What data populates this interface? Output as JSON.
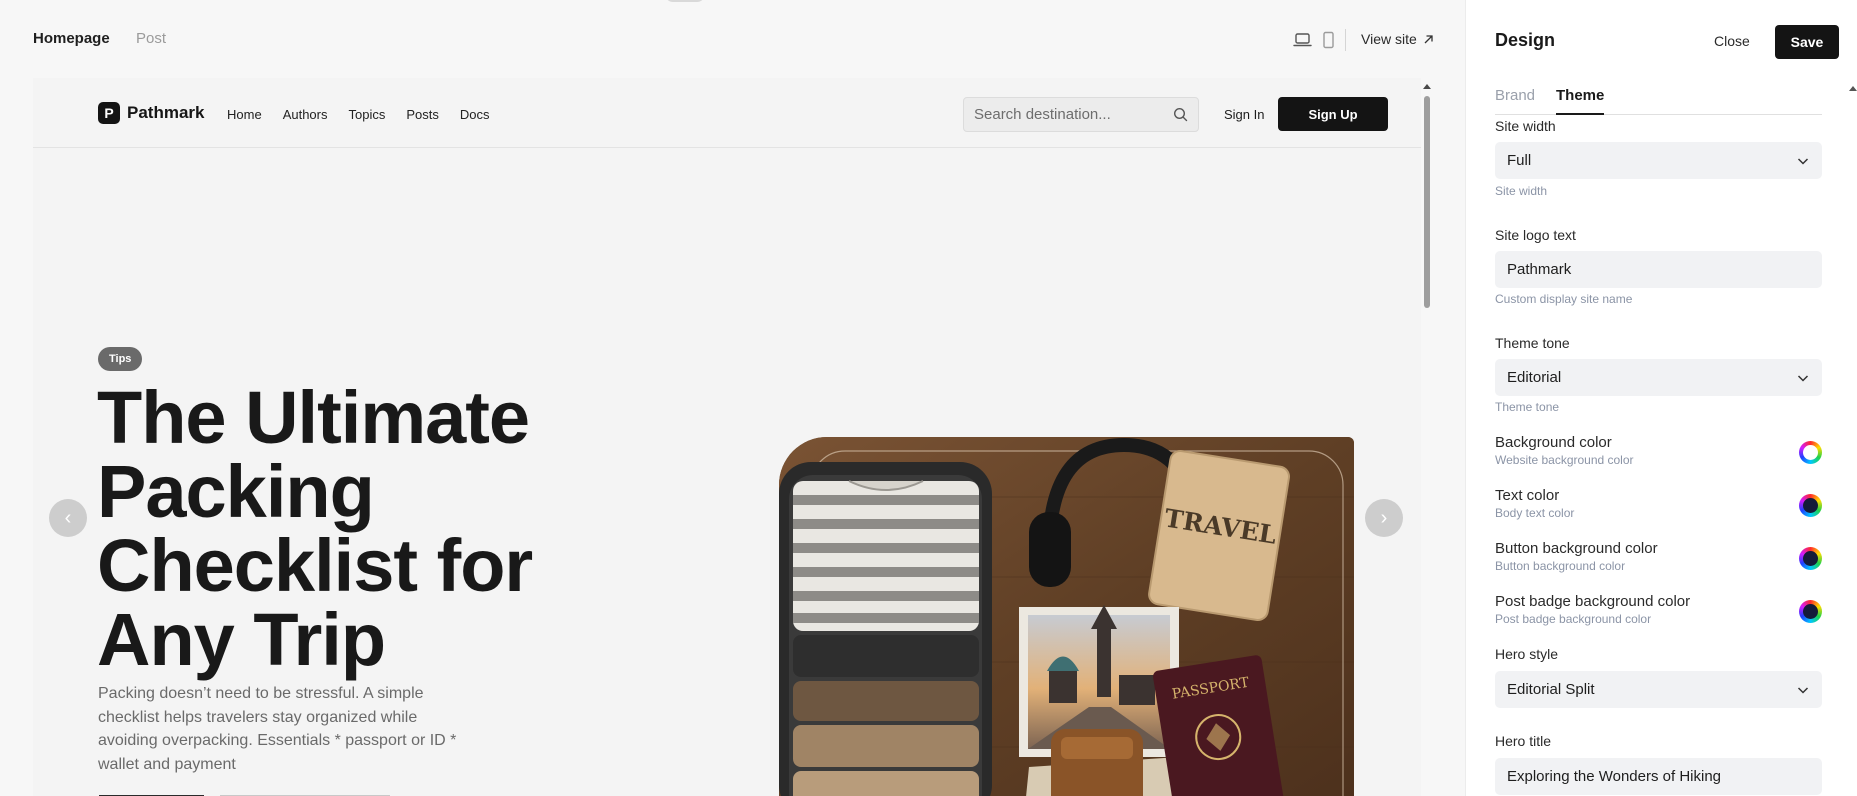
{
  "editor": {
    "tabs": [
      "Homepage",
      "Post"
    ],
    "view_site_label": "View site",
    "devices": [
      "desktop-icon",
      "mobile-icon"
    ]
  },
  "site": {
    "logo_letter": "P",
    "logo_text": "Pathmark",
    "nav": [
      "Home",
      "Authors",
      "Topics",
      "Posts",
      "Docs"
    ],
    "search_placeholder": "Search destination...",
    "sign_in": "Sign In",
    "sign_up": "Sign Up"
  },
  "hero": {
    "badge": "Tips",
    "title": "The Ultimate Packing Checklist for Any Trip",
    "description": "Packing doesn’t need to be stressful. A simple checklist helps travelers stay organized while avoiding overpacking. Essentials * passport or ID * wallet and payment",
    "prev_glyph": "‹",
    "next_glyph": "›",
    "image_texts": {
      "notebook": "TRAVEL",
      "passport": "PASSPORT"
    }
  },
  "panel": {
    "title": "Design",
    "close_label": "Close",
    "save_label": "Save",
    "tabs": [
      {
        "label": "Brand",
        "active": false
      },
      {
        "label": "Theme",
        "active": true
      }
    ],
    "site_width": {
      "label": "Site width",
      "value": "Full",
      "hint": "Site width"
    },
    "site_logo_text": {
      "label": "Site logo text",
      "value": "Pathmark",
      "hint": "Custom display site name"
    },
    "theme_tone": {
      "label": "Theme tone",
      "value": "Editorial",
      "hint": "Theme tone"
    },
    "colors": [
      {
        "label": "Background color",
        "hint": "Website background color",
        "color": "#ffffff"
      },
      {
        "label": "Text color",
        "hint": "Body text color",
        "color": "#141b3a"
      },
      {
        "label": "Button background color",
        "hint": "Button background color",
        "color": "#141b3a"
      },
      {
        "label": "Post badge background color",
        "hint": "Post badge background color",
        "color": "#141b3a"
      }
    ],
    "hero_style": {
      "label": "Hero style",
      "value": "Editorial Split"
    },
    "hero_title": {
      "label": "Hero title",
      "value": "Exploring the Wonders of Hiking"
    }
  }
}
